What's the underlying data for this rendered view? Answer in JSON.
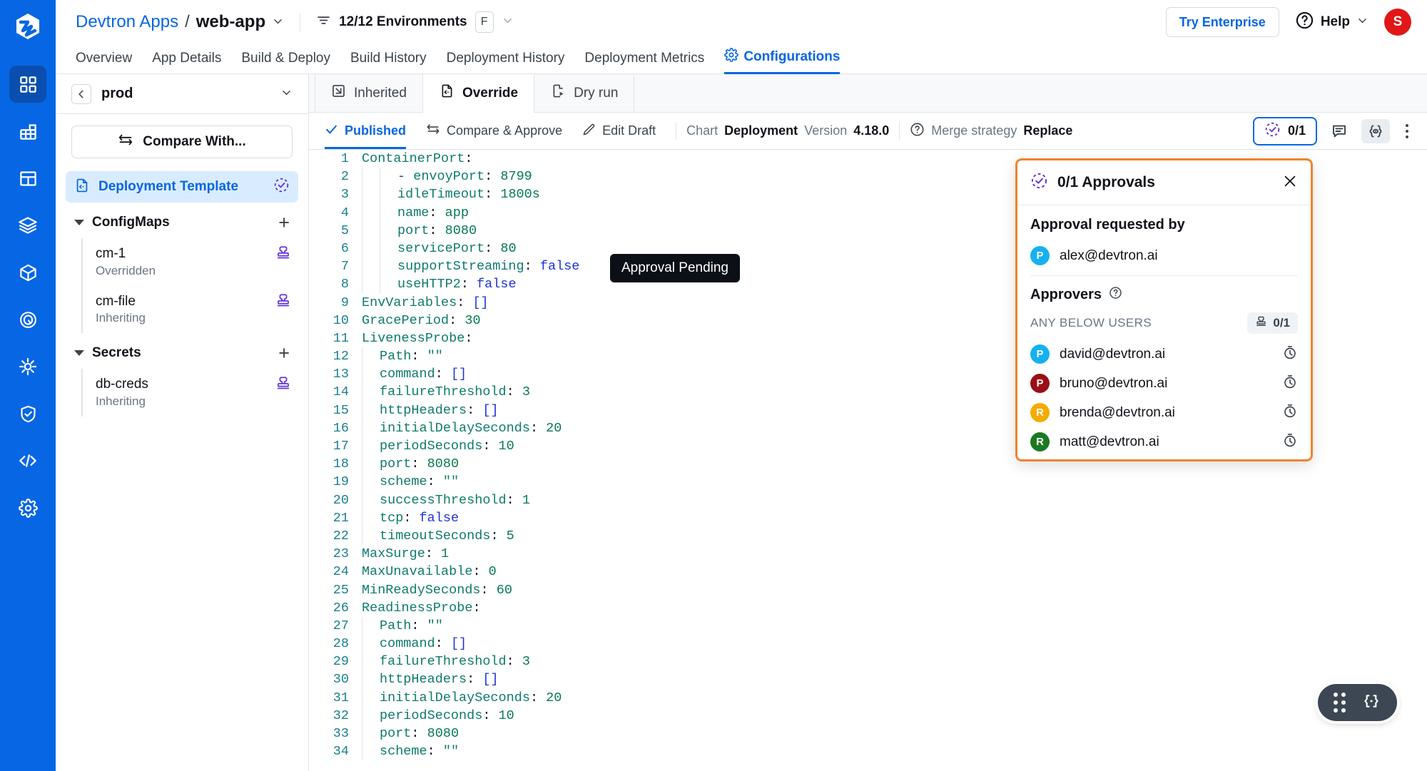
{
  "rail": {
    "logo_icon": "devtron-logo-icon",
    "items": [
      {
        "name": "applications-icon",
        "active": true
      },
      {
        "name": "jobs-icon",
        "active": false
      },
      {
        "name": "resource-browser-icon",
        "active": false
      },
      {
        "name": "chart-store-icon",
        "active": false
      },
      {
        "name": "software-distribution-icon",
        "active": false
      },
      {
        "name": "deployment-groups-icon",
        "active": false
      },
      {
        "name": "clusters-icon",
        "active": false
      },
      {
        "name": "security-icon",
        "active": false
      },
      {
        "name": "code-icon",
        "active": false
      },
      {
        "name": "global-configurations-icon",
        "active": false
      }
    ]
  },
  "header": {
    "breadcrumb_root": "Devtron Apps",
    "breadcrumb_sep": "/",
    "breadcrumb_current": "web-app",
    "env_filter_label": "12/12 Environments",
    "env_filter_kbd": "F",
    "try_enterprise": "Try Enterprise",
    "help_label": "Help",
    "avatar_initial": "S"
  },
  "app_nav": {
    "items": [
      {
        "label": "Overview",
        "active": false
      },
      {
        "label": "App Details",
        "active": false
      },
      {
        "label": "Build & Deploy",
        "active": false
      },
      {
        "label": "Build History",
        "active": false
      },
      {
        "label": "Deployment History",
        "active": false
      },
      {
        "label": "Deployment Metrics",
        "active": false
      },
      {
        "label": "Configurations",
        "active": true
      }
    ]
  },
  "sidebar": {
    "env_name": "prod",
    "compare_with": "Compare With...",
    "deployment_template": "Deployment Template",
    "groups": [
      {
        "label": "ConfigMaps",
        "items": [
          {
            "name": "cm-1",
            "status": "Overridden"
          },
          {
            "name": "cm-file",
            "status": "Inheriting"
          }
        ]
      },
      {
        "label": "Secrets",
        "items": [
          {
            "name": "db-creds",
            "status": "Inheriting"
          }
        ]
      }
    ]
  },
  "editor": {
    "tabs": [
      {
        "label": "Inherited",
        "icon": "inherited-icon",
        "active": false
      },
      {
        "label": "Override",
        "icon": "override-icon",
        "active": true
      },
      {
        "label": "Dry run",
        "icon": "dry-run-icon",
        "active": false
      }
    ],
    "toolbar": {
      "published": "Published",
      "compare_approve": "Compare & Approve",
      "edit_draft": "Edit Draft",
      "chart_label": "Chart",
      "chart_value": "Deployment",
      "version_label": "Version",
      "version_value": "4.18.0",
      "merge_strategy_label": "Merge strategy",
      "merge_strategy_value": "Replace",
      "approval_count": "0/1"
    },
    "tooltip": "Approval Pending",
    "code_lines": [
      {
        "n": 1,
        "indent": 0,
        "text": "ContainerPort:"
      },
      {
        "n": 2,
        "indent": 2,
        "text": "  - envoyPort: 8799"
      },
      {
        "n": 3,
        "indent": 2,
        "text": "    idleTimeout: 1800s"
      },
      {
        "n": 4,
        "indent": 2,
        "text": "    name: app"
      },
      {
        "n": 5,
        "indent": 2,
        "text": "    port: 8080"
      },
      {
        "n": 6,
        "indent": 2,
        "text": "    servicePort: 80"
      },
      {
        "n": 7,
        "indent": 2,
        "text": "    supportStreaming: false"
      },
      {
        "n": 8,
        "indent": 2,
        "text": "    useHTTP2: false"
      },
      {
        "n": 9,
        "indent": 0,
        "text": "EnvVariables: []"
      },
      {
        "n": 10,
        "indent": 0,
        "text": "GracePeriod: 30"
      },
      {
        "n": 11,
        "indent": 0,
        "text": "LivenessProbe:"
      },
      {
        "n": 12,
        "indent": 1,
        "text": "  Path: \"\""
      },
      {
        "n": 13,
        "indent": 1,
        "text": "  command: []"
      },
      {
        "n": 14,
        "indent": 1,
        "text": "  failureThreshold: 3"
      },
      {
        "n": 15,
        "indent": 1,
        "text": "  httpHeaders: []"
      },
      {
        "n": 16,
        "indent": 1,
        "text": "  initialDelaySeconds: 20"
      },
      {
        "n": 17,
        "indent": 1,
        "text": "  periodSeconds: 10"
      },
      {
        "n": 18,
        "indent": 1,
        "text": "  port: 8080"
      },
      {
        "n": 19,
        "indent": 1,
        "text": "  scheme: \"\""
      },
      {
        "n": 20,
        "indent": 1,
        "text": "  successThreshold: 1"
      },
      {
        "n": 21,
        "indent": 1,
        "text": "  tcp: false"
      },
      {
        "n": 22,
        "indent": 1,
        "text": "  timeoutSeconds: 5"
      },
      {
        "n": 23,
        "indent": 0,
        "text": "MaxSurge: 1"
      },
      {
        "n": 24,
        "indent": 0,
        "text": "MaxUnavailable: 0"
      },
      {
        "n": 25,
        "indent": 0,
        "text": "MinReadySeconds: 60"
      },
      {
        "n": 26,
        "indent": 0,
        "text": "ReadinessProbe:"
      },
      {
        "n": 27,
        "indent": 1,
        "text": "  Path: \"\""
      },
      {
        "n": 28,
        "indent": 1,
        "text": "  command: []"
      },
      {
        "n": 29,
        "indent": 1,
        "text": "  failureThreshold: 3"
      },
      {
        "n": 30,
        "indent": 1,
        "text": "  httpHeaders: []"
      },
      {
        "n": 31,
        "indent": 1,
        "text": "  initialDelaySeconds: 20"
      },
      {
        "n": 32,
        "indent": 1,
        "text": "  periodSeconds: 10"
      },
      {
        "n": 33,
        "indent": 1,
        "text": "  port: 8080"
      },
      {
        "n": 34,
        "indent": 1,
        "text": "  scheme: \"\""
      }
    ]
  },
  "approvals_popover": {
    "title": "0/1 Approvals",
    "requested_by_label": "Approval requested by",
    "requester": {
      "initial": "P",
      "email": "alex@devtron.ai",
      "color": "#14b1f0"
    },
    "approvers_label": "Approvers",
    "any_below_users": "ANY BELOW USERS",
    "approver_count": "0/1",
    "approvers": [
      {
        "initial": "P",
        "email": "david@devtron.ai",
        "color": "#14b1f0"
      },
      {
        "initial": "P",
        "email": "bruno@devtron.ai",
        "color": "#9c0d15"
      },
      {
        "initial": "R",
        "email": "brenda@devtron.ai",
        "color": "#f5ab00"
      },
      {
        "initial": "R",
        "email": "matt@devtron.ai",
        "color": "#1b7a20"
      }
    ]
  },
  "fab": {
    "drag_icon": "drag-handle-icon",
    "json_icon": "json-braces-icon"
  },
  "colors": {
    "brand_blue": "#0766e3",
    "rail_blue": "#0766e3",
    "accent_orange": "#f2822c",
    "avatar_red": "#e11717",
    "purple": "#6234d6"
  }
}
